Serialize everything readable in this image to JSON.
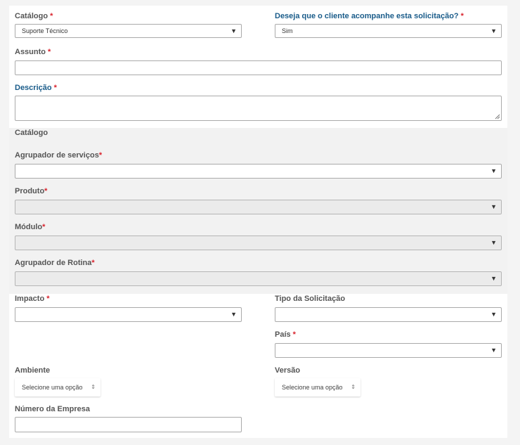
{
  "form": {
    "catalogo_label": "Catálogo",
    "catalogo_value": "Suporte Técnico",
    "acompanhe_label": "Deseja que o cliente acompanhe esta solicitação?",
    "acompanhe_value": "Sim",
    "assunto_label": "Assunto",
    "descricao_label": "Descrição",
    "section_catalogo_title": "Catálogo",
    "agrupador_servicos_label": "Agrupador de serviços",
    "produto_label": "Produto",
    "modulo_label": "Módulo",
    "agrupador_rotina_label": "Agrupador de Rotina",
    "impacto_label": "Impacto",
    "tipo_solicitacao_label": "Tipo da Solicitação",
    "pais_label": "País",
    "ambiente_label": "Ambiente",
    "ambiente_value": "Selecione uma opção",
    "versao_label": "Versão",
    "versao_value": "Selecione uma opção",
    "numero_empresa_label": "Número da Empresa",
    "required_mark": "*"
  },
  "icons": {
    "caret": "▼",
    "updown": "⇕"
  },
  "colors": {
    "required": "#d9232d",
    "blue_label": "#1a5c8a",
    "disabled_field": "#ebebeb"
  }
}
